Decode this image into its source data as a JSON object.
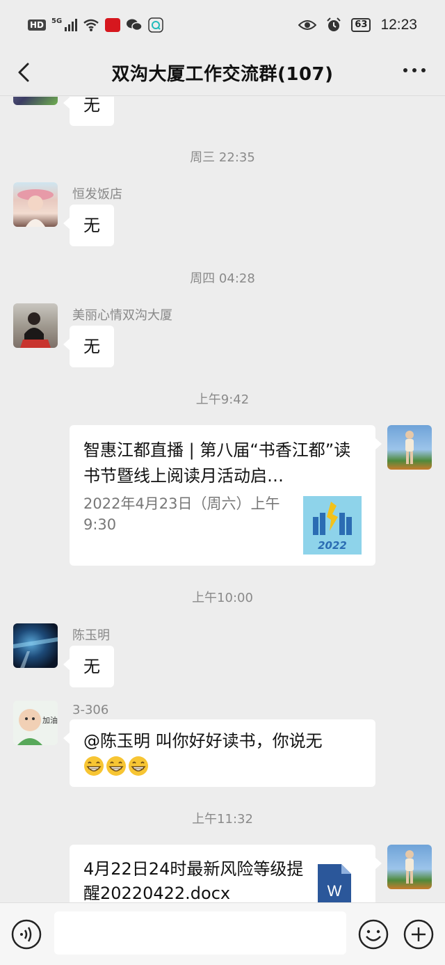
{
  "status_bar": {
    "hd": "HD",
    "network": "5G",
    "battery": "63",
    "time": "12:23"
  },
  "header": {
    "title": "双沟大厦工作交流群(107)",
    "back_icon": "chevron-left-icon",
    "more_icon": "more-dots-icon"
  },
  "messages": {
    "m0": {
      "text": "无"
    },
    "t1": "周三 22:35",
    "m1": {
      "sender": "恒发饭店",
      "text": "无"
    },
    "t2": "周四 04:28",
    "m2": {
      "sender": "美丽心情双沟大厦",
      "text": "无"
    },
    "t3": "上午9:42",
    "card": {
      "title": "智惠江都直播 | 第八届“书香江都”读书节暨线上阅读月活动启…",
      "desc": "2022年4月23日（周六）上午9:30",
      "thumb_text": "2022"
    },
    "t4": "上午10:00",
    "m3": {
      "sender": "陈玉明",
      "text": "无"
    },
    "m4": {
      "sender": "3-306",
      "avatar_text": "加油",
      "text": "@陈玉明  叫你好好读书，你说无",
      "emojis": "😁😁😁"
    },
    "t5": "上午11:32",
    "file": {
      "title": "4月22日24时最新风险等级提醒20220422.docx",
      "icon_letter": "W"
    }
  },
  "bottom_bar": {
    "voice_icon": "voice-icon",
    "emoji_icon": "emoji-icon",
    "plus_icon": "plus-icon"
  },
  "colors": {
    "background": "#ededed",
    "bubble": "#ffffff",
    "timestamp": "#8a8a8a",
    "word_blue": "#2b579a"
  }
}
